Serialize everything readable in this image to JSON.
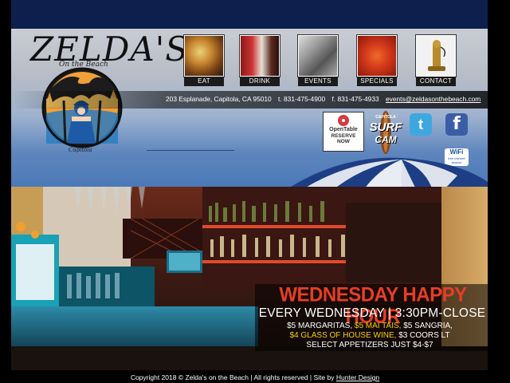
{
  "logo": {
    "name": "ZELDA'S",
    "tagline": "On the Beach",
    "emblem_signature": "Capitola"
  },
  "nav": [
    {
      "label": "EAT",
      "icon": "food-photo"
    },
    {
      "label": "DRINK",
      "icon": "drink-photo"
    },
    {
      "label": "EVENTS",
      "icon": "guitar-photo"
    },
    {
      "label": "SPECIALS",
      "icon": "lobster-photo"
    },
    {
      "label": "CONTACT",
      "icon": "telephone-photo"
    }
  ],
  "contact": {
    "address": "203 Esplanade, Capitola, CA 95010",
    "phone": "t. 831-475-4900",
    "fax": "f. 831-475-4933",
    "email": "events@zeldasonthebeach.com"
  },
  "opentable": {
    "brand": "OpenTable",
    "line1": "RESERVE",
    "line2": "NOW"
  },
  "surfcam": {
    "line1": "CAPITOLA",
    "line2": "SURF",
    "line3": "CAM"
  },
  "social": {
    "twitter": "t",
    "facebook": "f"
  },
  "wifi": {
    "label": "WiFi",
    "sub": "free internet access"
  },
  "promo": {
    "title": "WEDNESDAY HAPPY HOUR",
    "subtitle": "EVERY WEDNESDAY | 3:30PM-CLOSE",
    "line1_a": "$5 MARGARITAS,",
    "line1_b": "$5 MAI TAIS,",
    "line1_c": "$5 SANGRIA,",
    "line2_a": "$4 GLASS OF HOUSE WINE,",
    "line2_b": "$3 COORS LT",
    "line3": "SELECT APPETIZERS JUST $4-$7"
  },
  "footer": {
    "copyright": "Copyright 2018 © Zelda's on the Beach  |  All rights reserved  |  Site by",
    "designer": "Hunter Design"
  },
  "colors": {
    "topbar": "#0e1f4e",
    "accent_red": "#e83d25",
    "accent_yellow": "#f7d000"
  }
}
